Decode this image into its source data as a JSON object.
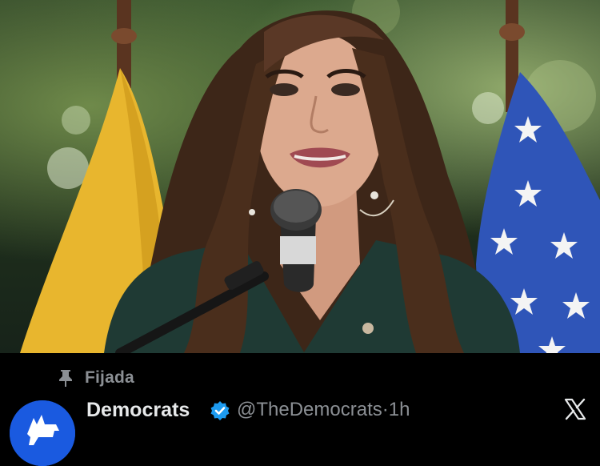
{
  "tweet": {
    "pinned_label": "Fijada",
    "display_name": "Democrats",
    "handle": "@TheDemocrats",
    "separator": "·",
    "time": "1h"
  },
  "icons": {
    "pin": "pin-icon",
    "verified": "verified-badge-icon",
    "platform": "x-logo-icon",
    "avatar": "donkey-logo-avatar"
  },
  "colors": {
    "background": "#000000",
    "primary_text": "#e7e9ea",
    "secondary_text": "#8b8f94",
    "verified_blue": "#1d9bf0",
    "avatar_blue": "#1a5ae0"
  }
}
